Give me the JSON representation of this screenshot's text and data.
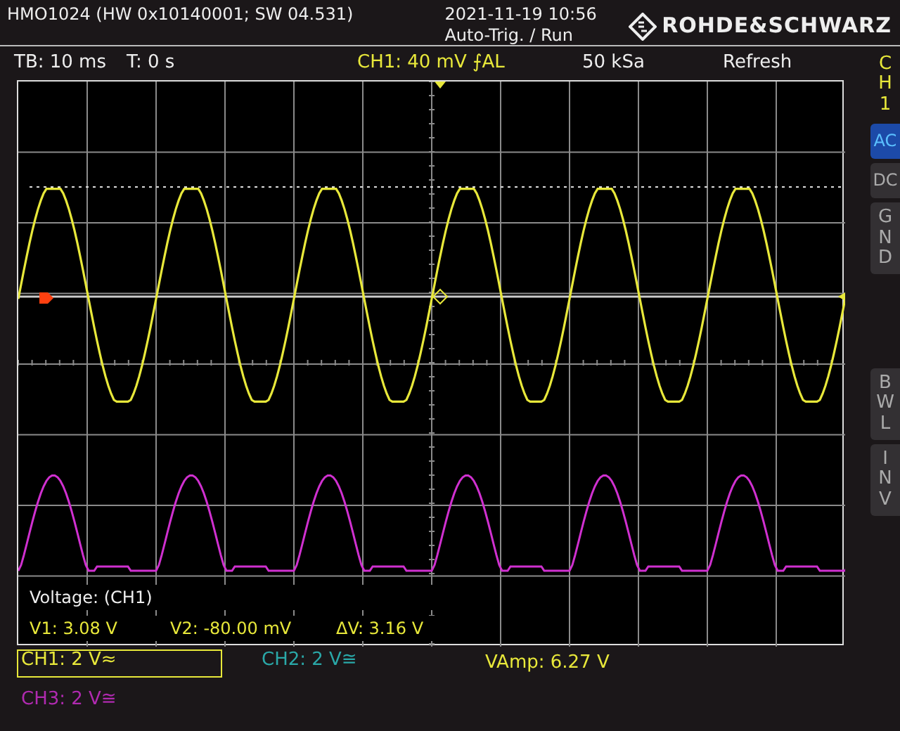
{
  "header": {
    "device_info": "HMO1024 (HW 0x10140001; SW 04.531)",
    "datetime": "2021-11-19 10:56",
    "trigger_status": "Auto-Trig. / Run",
    "brand": "ROHDE&SCHWARZ"
  },
  "info_bar": {
    "timebase": "TB: 10 ms",
    "trigger_time": "T: 0 s",
    "trigger": "CH1: 40 mV ⨍AL",
    "sample_rate": "50 kSa",
    "mode": "Refresh"
  },
  "side_panel": {
    "channel": "CH1",
    "buttons": [
      {
        "label": "AC",
        "kind": "horizontal",
        "selected": true
      },
      {
        "label": "DC",
        "kind": "horizontal",
        "selected": false
      },
      {
        "label": "GND",
        "kind": "vertical",
        "selected": false
      },
      {
        "label": "BWL",
        "kind": "vertical",
        "selected": false
      },
      {
        "label": "INV",
        "kind": "vertical",
        "selected": false
      }
    ]
  },
  "measurement": {
    "title": "Voltage: (CH1)",
    "values": [
      "V1: 3.08 V",
      "V2: -80.00 mV",
      "ΔV: 3.16 V"
    ]
  },
  "channels": [
    {
      "label": "CH1: 2 V≈",
      "color": "#e8e83a",
      "selected": true
    },
    {
      "label": "CH2: 2 V≅",
      "color": "#2aa8a8",
      "selected": false
    },
    {
      "label": "CH3: 2 V≅",
      "color": "#b02ab0",
      "selected": false
    }
  ],
  "readout": "VAmp: 6.27 V"
}
